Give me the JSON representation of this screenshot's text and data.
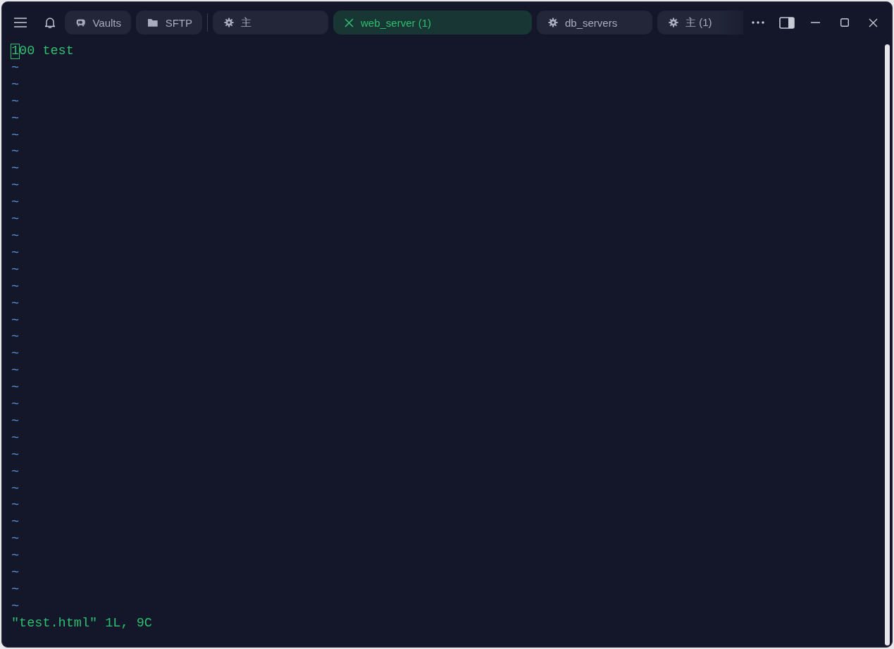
{
  "tabs": [
    {
      "kind": "vaults",
      "label": "Vaults",
      "selected": false
    },
    {
      "kind": "sftp",
      "label": "SFTP",
      "selected": false
    },
    {
      "kind": "host",
      "label": "主",
      "selected": false
    },
    {
      "label": "web_server (1)",
      "selected": true
    },
    {
      "kind": "host",
      "label": "db_servers",
      "selected": false
    },
    {
      "kind": "host",
      "label": "主 (1)",
      "selected": false
    }
  ],
  "terminal": {
    "lines": [
      {
        "text": "100 test",
        "cursor": true
      }
    ],
    "empty_lines": [
      "~",
      "~",
      "~",
      "~",
      "~",
      "~",
      "~",
      "~",
      "~",
      "~",
      "~",
      "~",
      "~",
      "~",
      "~",
      "~",
      "~",
      "~",
      "~",
      "~",
      "~",
      "~",
      "~",
      "~",
      "~",
      "~",
      "~",
      "~",
      "~",
      "~",
      "~",
      "~",
      "~"
    ],
    "status_line": "\"test.html\" 1L, 9C"
  }
}
